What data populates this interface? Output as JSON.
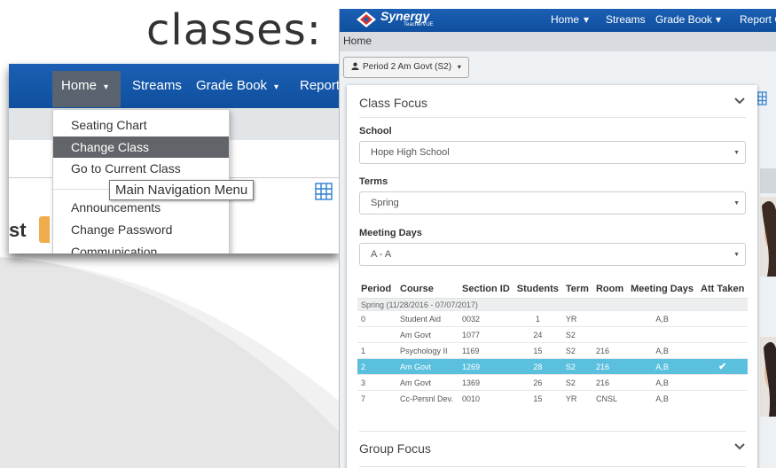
{
  "slide": {
    "title": "classes:"
  },
  "nav": {
    "items": [
      {
        "label": "Home",
        "caret": "▾"
      },
      {
        "label": "Streams"
      },
      {
        "label": "Grade Book",
        "caret": "▾"
      },
      {
        "label": "Report"
      }
    ],
    "dropdown": [
      "Seating Chart",
      "Change Class",
      "Go to Current Class",
      "Announcements",
      "Change Password",
      "Communication"
    ],
    "active_item": "Change Class",
    "tooltip": "Main Navigation Menu",
    "partial_text": "st"
  },
  "app": {
    "logo": {
      "name": "Synergy",
      "sub": "TeacherVUE"
    },
    "top_nav": [
      "Home",
      "▾",
      "Streams",
      "Grade Book",
      "▾",
      "Report C"
    ],
    "breadcrumb": "Home",
    "period_selector": "Period 2 Am Govt (S2)",
    "period_caret": "▾"
  },
  "class_focus": {
    "title": "Class Focus",
    "school": {
      "label": "School",
      "value": "Hope High School"
    },
    "terms": {
      "label": "Terms",
      "value": "Spring"
    },
    "meeting_days": {
      "label": "Meeting Days",
      "value": "A - A"
    },
    "columns": [
      "Period",
      "Course",
      "Section ID",
      "Students",
      "Term",
      "Room",
      "Meeting Days",
      "Att Taken"
    ],
    "term_group": "Spring (11/28/2016 - 07/07/2017)",
    "rows": [
      [
        "0",
        "Student Aid",
        "0032",
        "1",
        "YR",
        "",
        "A,B",
        ""
      ],
      [
        "",
        "Am Govt",
        "1077",
        "24",
        "S2",
        "",
        "",
        ""
      ],
      [
        "1",
        "Psychology II",
        "1169",
        "15",
        "S2",
        "216",
        "A,B",
        ""
      ],
      [
        "2",
        "Am Govt",
        "1269",
        "28",
        "S2",
        "216",
        "A,B",
        "✔"
      ],
      [
        "3",
        "Am Govt",
        "1369",
        "26",
        "S2",
        "216",
        "A,B",
        ""
      ],
      [
        "7",
        "Cc-Persnl Dev.",
        "0010",
        "15",
        "YR",
        "CNSL",
        "A,B",
        ""
      ]
    ],
    "selected_row": 3
  },
  "group_focus": {
    "title": "Group Focus"
  },
  "colors": {
    "nav_blue": "#1565c0",
    "selected_row": "#5bc0de",
    "active_menu": "#616469",
    "orange": "#f0ad4e"
  }
}
